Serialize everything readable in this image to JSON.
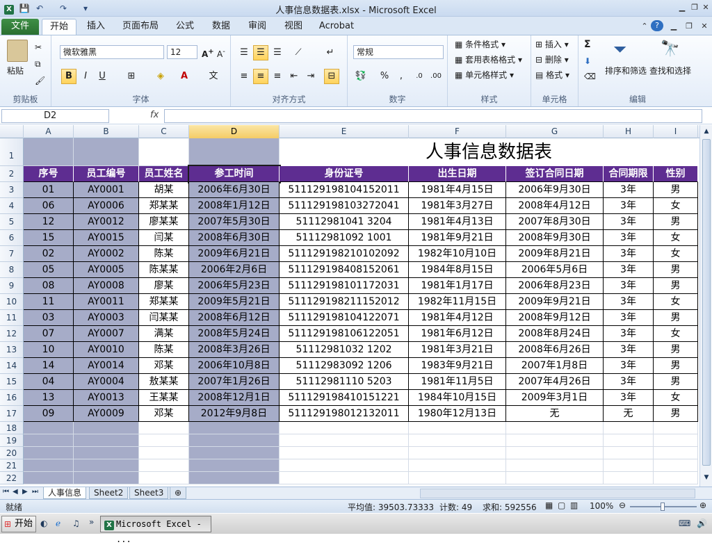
{
  "window": {
    "title": "人事信息数据表.xlsx - Microsoft Excel"
  },
  "ribbon": {
    "tabs": [
      "文件",
      "开始",
      "插入",
      "页面布局",
      "公式",
      "数据",
      "审阅",
      "视图",
      "Acrobat"
    ],
    "clipboard": {
      "paste": "粘贴",
      "label": "剪贴板"
    },
    "font": {
      "name": "微软雅黑",
      "size": "12",
      "label": "字体",
      "bold": "B",
      "italic": "I",
      "underline": "U"
    },
    "alignment": {
      "label": "对齐方式"
    },
    "number": {
      "format": "常规",
      "label": "数字",
      "percent": "%",
      "comma": ","
    },
    "styles": {
      "conditional": "条件格式",
      "table_format": "套用表格格式",
      "cell_styles": "单元格样式",
      "label": "样式"
    },
    "cells": {
      "insert": "插入",
      "delete": "删除",
      "format": "格式",
      "label": "单元格"
    },
    "editing": {
      "sort_filter": "排序和筛选",
      "find_select": "查找和选择",
      "label": "编辑",
      "sum": "Σ"
    }
  },
  "formula_bar": {
    "name_box": "D2",
    "fx": "fx",
    "value": ""
  },
  "columns": [
    "A",
    "B",
    "C",
    "D",
    "E",
    "F",
    "G",
    "H",
    "I"
  ],
  "selected_column": "D",
  "rows": [
    "1",
    "2",
    "3",
    "4",
    "5",
    "6",
    "7",
    "8",
    "9",
    "10",
    "11",
    "12",
    "13",
    "14",
    "15",
    "16",
    "17",
    "18",
    "19",
    "20",
    "21",
    "22"
  ],
  "sheet_title": "人事信息数据表",
  "headers": [
    "序号",
    "员工编号",
    "员工姓名",
    "参工时间",
    "身份证号",
    "出生日期",
    "签订合同日期",
    "合同期限",
    "性别"
  ],
  "data": [
    [
      "01",
      "AY0001",
      "胡某",
      "2006年6月30日",
      "511129198104152011",
      "1981年4月15日",
      "2006年9月30日",
      "3年",
      "男"
    ],
    [
      "06",
      "AY0006",
      "郑某某",
      "2008年1月12日",
      "511129198103272041",
      "1981年3月27日",
      "2008年4月12日",
      "3年",
      "女"
    ],
    [
      "12",
      "AY0012",
      "廖某某",
      "2007年5月30日",
      "51112981041 3204",
      "1981年4月13日",
      "2007年8月30日",
      "3年",
      "男"
    ],
    [
      "15",
      "AY0015",
      "闫某",
      "2008年6月30日",
      "51112981092 1001",
      "1981年9月21日",
      "2008年9月30日",
      "3年",
      "女"
    ],
    [
      "02",
      "AY0002",
      "陈某",
      "2009年6月21日",
      "511129198210102092",
      "1982年10月10日",
      "2009年8月21日",
      "3年",
      "女"
    ],
    [
      "05",
      "AY0005",
      "陈某某",
      "2006年2月6日",
      "511129198408152061",
      "1984年8月15日",
      "2006年5月6日",
      "3年",
      "男"
    ],
    [
      "08",
      "AY0008",
      "廖某",
      "2006年5月23日",
      "511129198101172031",
      "1981年1月17日",
      "2006年8月23日",
      "3年",
      "男"
    ],
    [
      "11",
      "AY0011",
      "郑某某",
      "2009年5月21日",
      "511129198211152012",
      "1982年11月15日",
      "2009年9月21日",
      "3年",
      "女"
    ],
    [
      "03",
      "AY0003",
      "闫某某",
      "2008年6月12日",
      "511129198104122071",
      "1981年4月12日",
      "2008年9月12日",
      "3年",
      "男"
    ],
    [
      "07",
      "AY0007",
      "满某",
      "2008年5月24日",
      "511129198106122051",
      "1981年6月12日",
      "2008年8月24日",
      "3年",
      "女"
    ],
    [
      "10",
      "AY0010",
      "陈某",
      "2008年3月26日",
      "51112981032 1202",
      "1981年3月21日",
      "2008年6月26日",
      "3年",
      "男"
    ],
    [
      "14",
      "AY0014",
      "邓某",
      "2006年10月8日",
      "51112983092 1206",
      "1983年9月21日",
      "2007年1月8日",
      "3年",
      "男"
    ],
    [
      "04",
      "AY0004",
      "敖某某",
      "2007年1月26日",
      "51112981110 5203",
      "1981年11月5日",
      "2007年4月26日",
      "3年",
      "男"
    ],
    [
      "13",
      "AY0013",
      "王某某",
      "2008年12月1日",
      "511129198410151221",
      "1984年10月15日",
      "2009年3月1日",
      "3年",
      "女"
    ],
    [
      "09",
      "AY0009",
      "邓某",
      "2012年9月8日",
      "511129198012132011",
      "1980年12月13日",
      "无",
      "无",
      "男"
    ]
  ],
  "sheets": [
    "人事信息",
    "Sheet2",
    "Sheet3"
  ],
  "status": {
    "ready": "就绪",
    "average": "平均值: 39503.73333",
    "count": "计数: 49",
    "sum": "求和: 592556",
    "zoom": "100%"
  },
  "taskbar": {
    "start": "开始",
    "item": "Microsoft Excel - ..."
  }
}
